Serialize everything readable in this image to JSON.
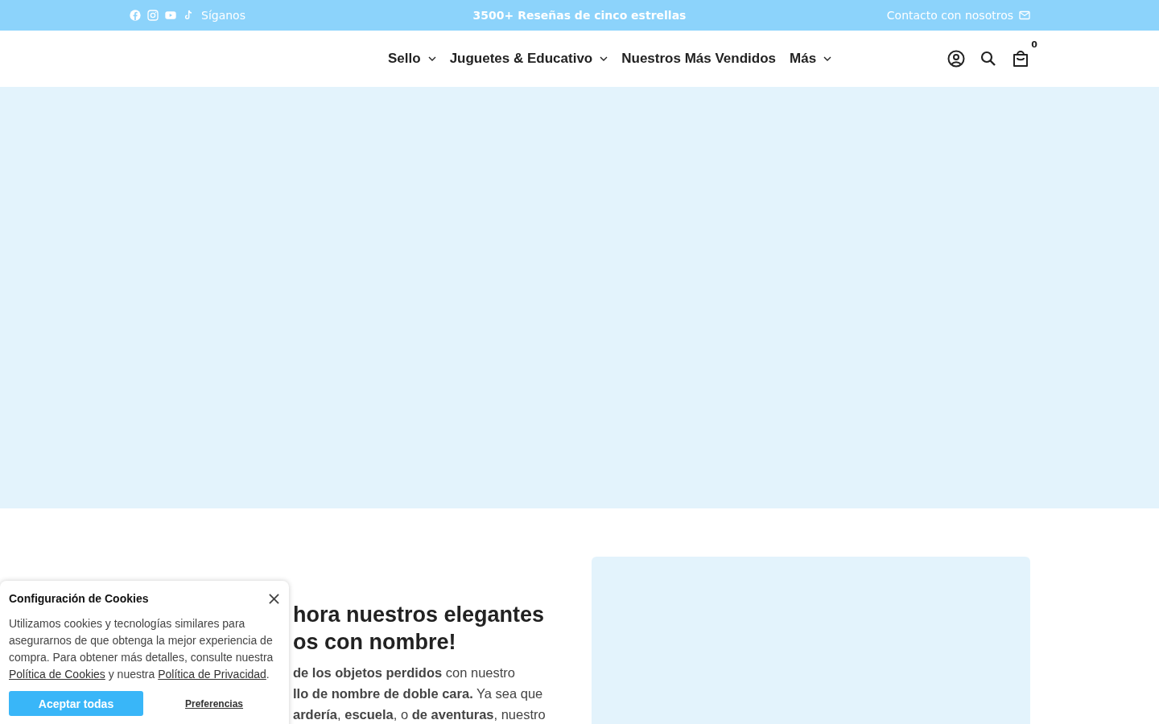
{
  "topbar": {
    "follow_label": "Síganos",
    "announcement": "3500+ Reseñas de cinco estrellas",
    "contact": "Contacto con nosotros"
  },
  "nav": {
    "items": [
      {
        "label": "Sello",
        "has_dropdown": true
      },
      {
        "label": "Juguetes & Educativo",
        "has_dropdown": true
      },
      {
        "label": "Nuestros Más Vendidos",
        "has_dropdown": false
      },
      {
        "label": "Más",
        "has_dropdown": true
      }
    ],
    "cart_count": "0"
  },
  "feature": {
    "heading_lines": [
      "hora nuestros elegantes",
      "os con nombre!"
    ],
    "paragraph_lines": [
      "**de los objetos perdidos** con nuestro",
      "**llo de nombre de doble cara.** Ya sea que",
      "**ardería**, **escuela**, o **de aventuras**, nuestro"
    ]
  },
  "cookie_banner": {
    "title": "Configuración de Cookies",
    "text": "Utilizamos cookies y tecnologías similares para asegurarnos de que obtenga la mejor experiencia de compra. Para obtener más detalles, consulte nuestra",
    "cookie_link": "Política de Cookies",
    "joiner": "y nuestra",
    "privacy_link": "Política de Privacidad",
    "end": ".",
    "accept_button": "Aceptar todas",
    "preferences_button": "Preferencias"
  }
}
